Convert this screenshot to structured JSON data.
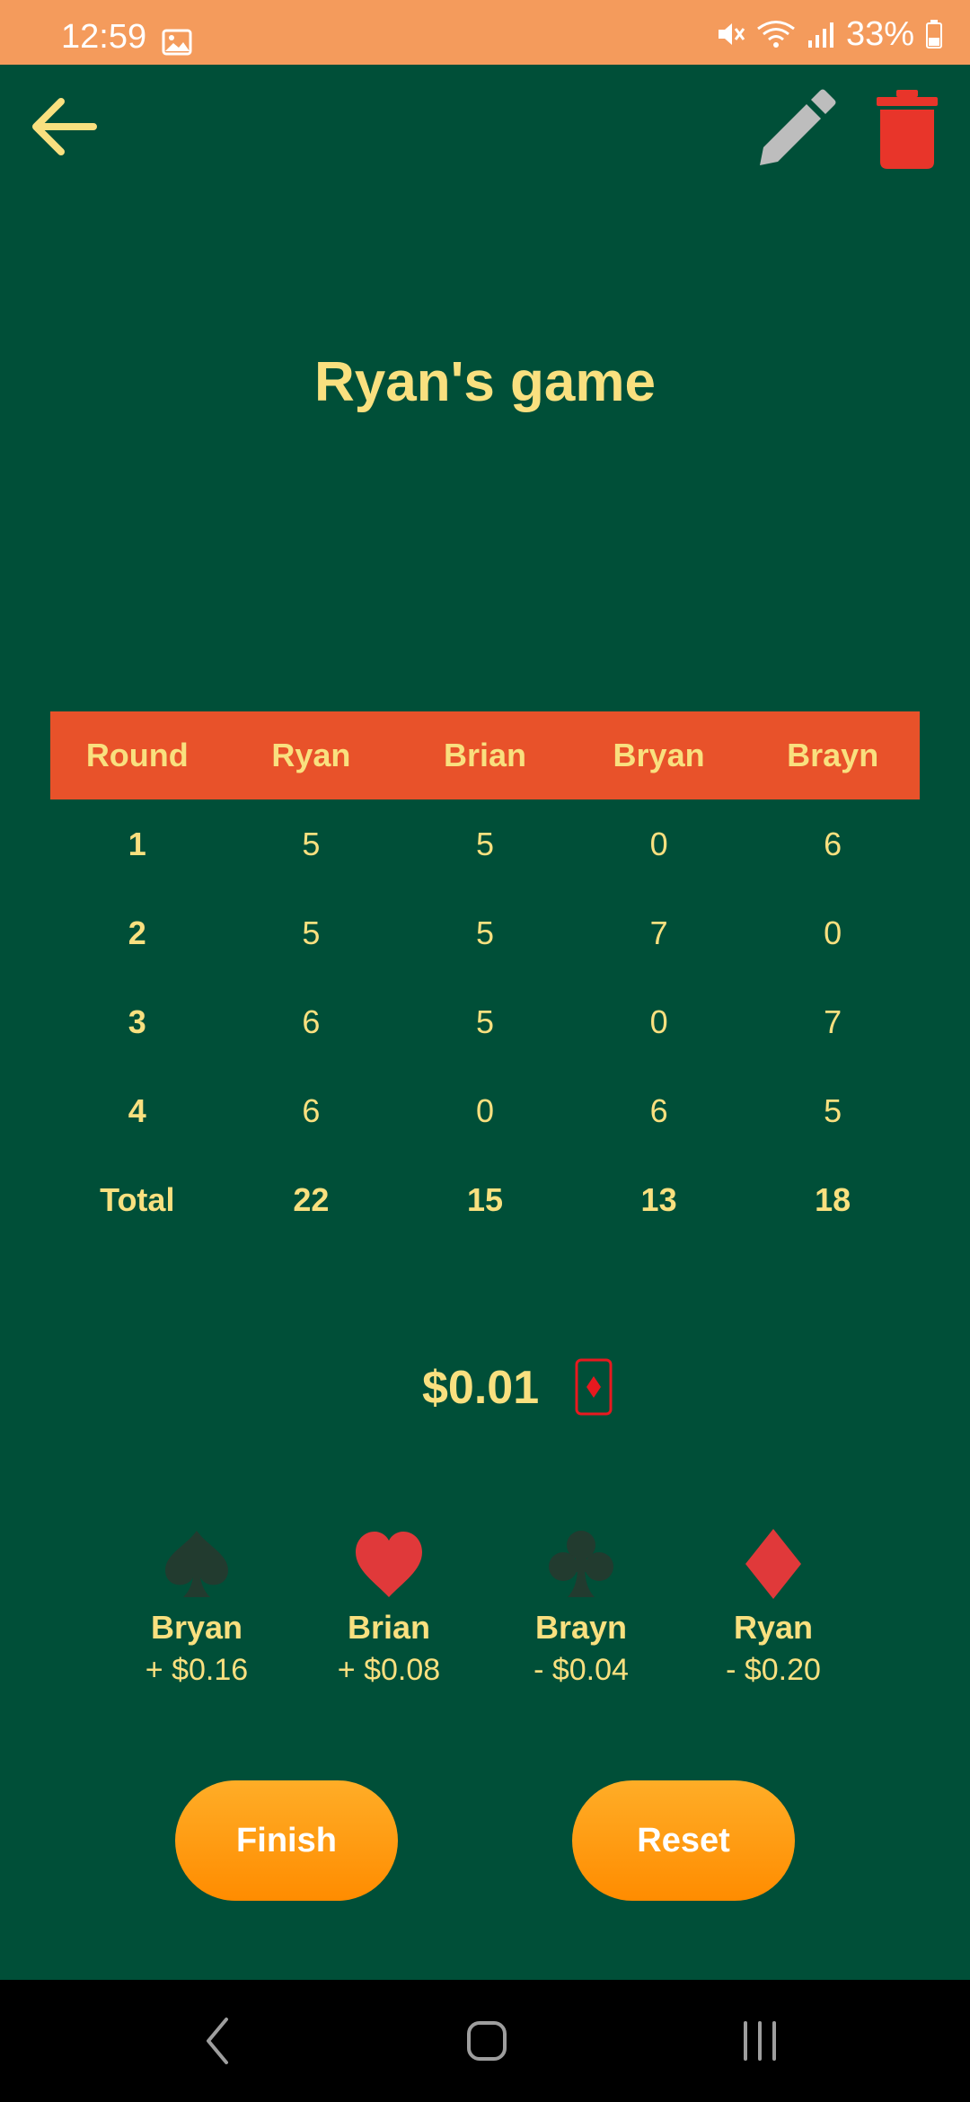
{
  "status_bar": {
    "time": "12:59",
    "battery": "33%",
    "icons": [
      "gallery-icon",
      "mute-icon",
      "wifi-icon",
      "signal-icon",
      "battery-icon"
    ]
  },
  "toolbar": {
    "back_icon": "arrow-left-icon",
    "edit_icon": "pencil-icon",
    "delete_icon": "trash-icon"
  },
  "game": {
    "title": "Ryan's game"
  },
  "table": {
    "headers": [
      "Round",
      "Ryan",
      "Brian",
      "Bryan",
      "Brayn"
    ],
    "rows": [
      [
        "1",
        "5",
        "5",
        "0",
        "6"
      ],
      [
        "2",
        "5",
        "5",
        "7",
        "0"
      ],
      [
        "3",
        "6",
        "5",
        "0",
        "7"
      ],
      [
        "4",
        "6",
        "0",
        "6",
        "5"
      ]
    ],
    "total": [
      "Total",
      "22",
      "15",
      "13",
      "18"
    ]
  },
  "pot": {
    "amount": "$0.01",
    "icon": "diamond-card-icon"
  },
  "results": [
    {
      "suit": "spade-icon",
      "name": "Bryan",
      "amount": "+ $0.16"
    },
    {
      "suit": "heart-icon",
      "name": "Brian",
      "amount": "+ $0.08"
    },
    {
      "suit": "club-icon",
      "name": "Brayn",
      "amount": "- $0.04"
    },
    {
      "suit": "diamond-icon",
      "name": "Ryan",
      "amount": "- $0.20"
    }
  ],
  "actions": {
    "finish_label": "Finish",
    "reset_label": "Reset"
  },
  "colors": {
    "background": "#004f38",
    "status_bar": "#f49b5c",
    "accent_text": "#f9e07f",
    "table_header": "#e8522a",
    "button": "#ff9a10",
    "delete_red": "#e8352a",
    "black_suit": "#223b2f",
    "red_suit": "#e0393a"
  }
}
